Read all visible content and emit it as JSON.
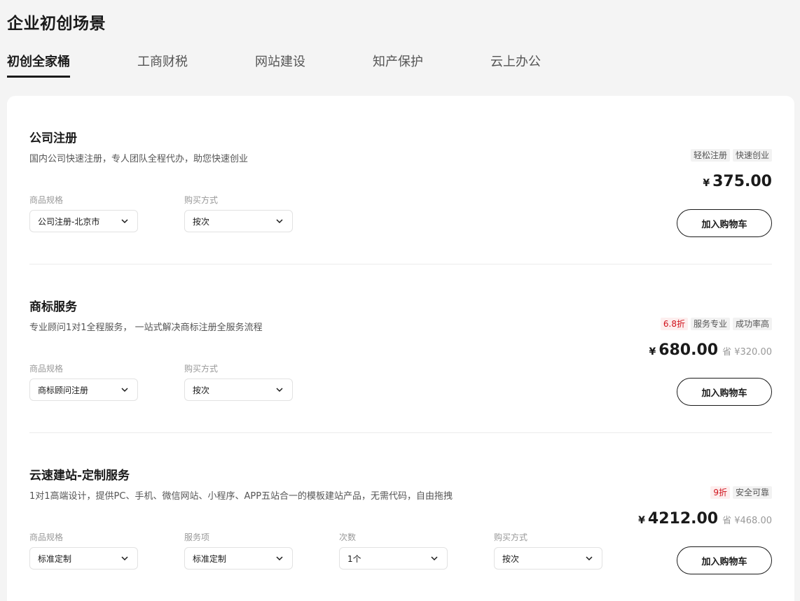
{
  "page": {
    "title": "企业初创场景"
  },
  "tabs": [
    {
      "label": "初创全家桶",
      "active": true
    },
    {
      "label": "工商财税",
      "active": false
    },
    {
      "label": "网站建设",
      "active": false
    },
    {
      "label": "知产保护",
      "active": false
    },
    {
      "label": "云上办公",
      "active": false
    }
  ],
  "products": [
    {
      "name": "公司注册",
      "description": "国内公司快速注册，专人团队全程代办，助您快速创业",
      "tags": [
        {
          "text": "轻松注册",
          "type": "normal"
        },
        {
          "text": "快速创业",
          "type": "normal"
        }
      ],
      "currency": "¥",
      "price": "375.00",
      "save": "",
      "fields": [
        {
          "label": "商品规格",
          "value": "公司注册-北京市"
        },
        {
          "label": "购买方式",
          "value": "按次"
        }
      ],
      "cart_label": "加入购物车"
    },
    {
      "name": "商标服务",
      "description": "专业顾问1对1全程服务， 一站式解决商标注册全服务流程",
      "tags": [
        {
          "text": "6.8折",
          "type": "discount"
        },
        {
          "text": "服务专业",
          "type": "normal"
        },
        {
          "text": "成功率高",
          "type": "normal"
        }
      ],
      "currency": "¥",
      "price": "680.00",
      "save": "省 ¥320.00",
      "fields": [
        {
          "label": "商品规格",
          "value": "商标顾问注册"
        },
        {
          "label": "购买方式",
          "value": "按次"
        }
      ],
      "cart_label": "加入购物车"
    },
    {
      "name": "云速建站-定制服务",
      "description": "1对1高端设计，提供PC、手机、微信网站、小程序、APP五站合一的模板建站产品，无需代码，自由拖拽",
      "tags": [
        {
          "text": "9折",
          "type": "discount"
        },
        {
          "text": "安全可靠",
          "type": "normal"
        }
      ],
      "currency": "¥",
      "price": "4212.00",
      "save": "省 ¥468.00",
      "fields": [
        {
          "label": "商品规格",
          "value": "标准定制"
        },
        {
          "label": "服务项",
          "value": "标准定制"
        },
        {
          "label": "次数",
          "value": "1个"
        },
        {
          "label": "购买方式",
          "value": "按次"
        }
      ],
      "cart_label": "加入购物车"
    }
  ],
  "icons": {
    "select_arrow": "chevron-down-icon"
  }
}
